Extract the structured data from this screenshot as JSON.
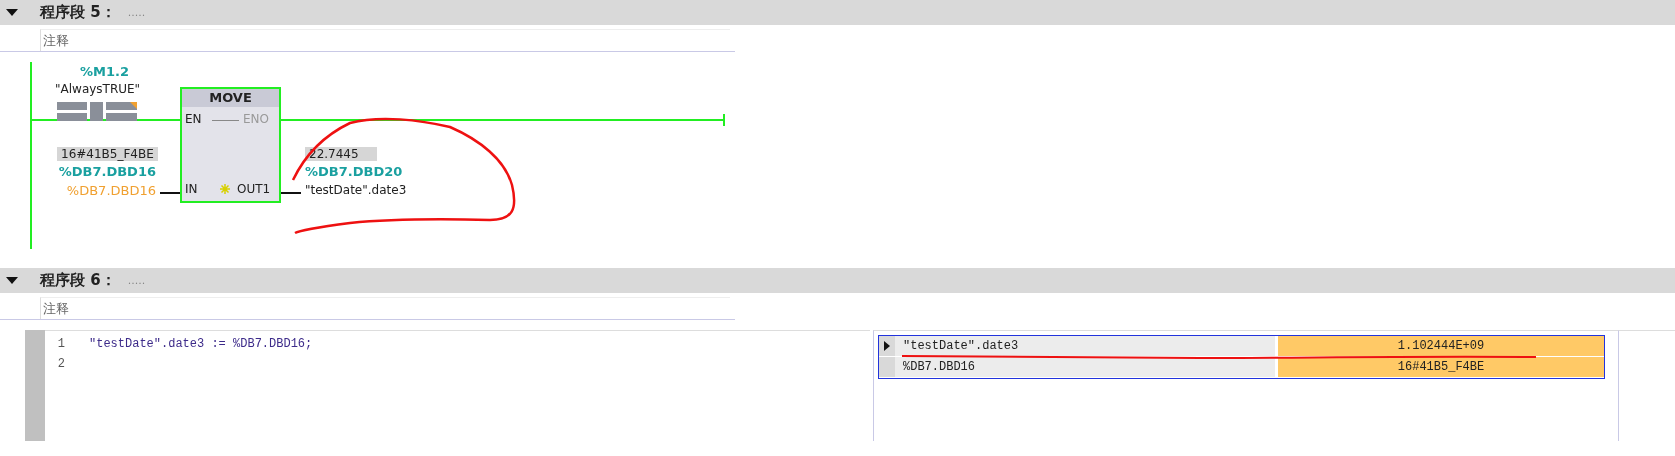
{
  "networks": [
    {
      "kind": "ladder",
      "expanded": true,
      "title": "程序段 5：",
      "dots": ".....",
      "comment": {
        "placeholder": "注释"
      },
      "ladder": {
        "contact": {
          "address": "%M1.2",
          "symbol": "\"AlwaysTRUE\""
        },
        "block": {
          "title": "MOVE",
          "en": "EN",
          "eno": "ENO",
          "in": "IN",
          "out": "OUT1"
        },
        "input": {
          "value": "16#41B5_F4BE",
          "address": "%DB7.DBD16",
          "operand": "%DB7.DBD16"
        },
        "output": {
          "value": "22.7445",
          "address": "%DB7.DBD20",
          "operand": "\"testDate\".date3"
        }
      }
    },
    {
      "kind": "scl",
      "expanded": true,
      "title": "程序段 6：",
      "dots": ".....",
      "comment": {
        "placeholder": "注释"
      },
      "code": [
        {
          "number": "1",
          "text": "\"testDate\".date3 := %DB7.DBD16;"
        },
        {
          "number": "2"
        }
      ],
      "watch": [
        {
          "name": "\"testDate\".date3",
          "value": "1.102444E+09",
          "selected": true
        },
        {
          "name": "%DB7.DBD16",
          "value": "16#41B5_F4BE",
          "selected": false
        }
      ]
    }
  ]
}
